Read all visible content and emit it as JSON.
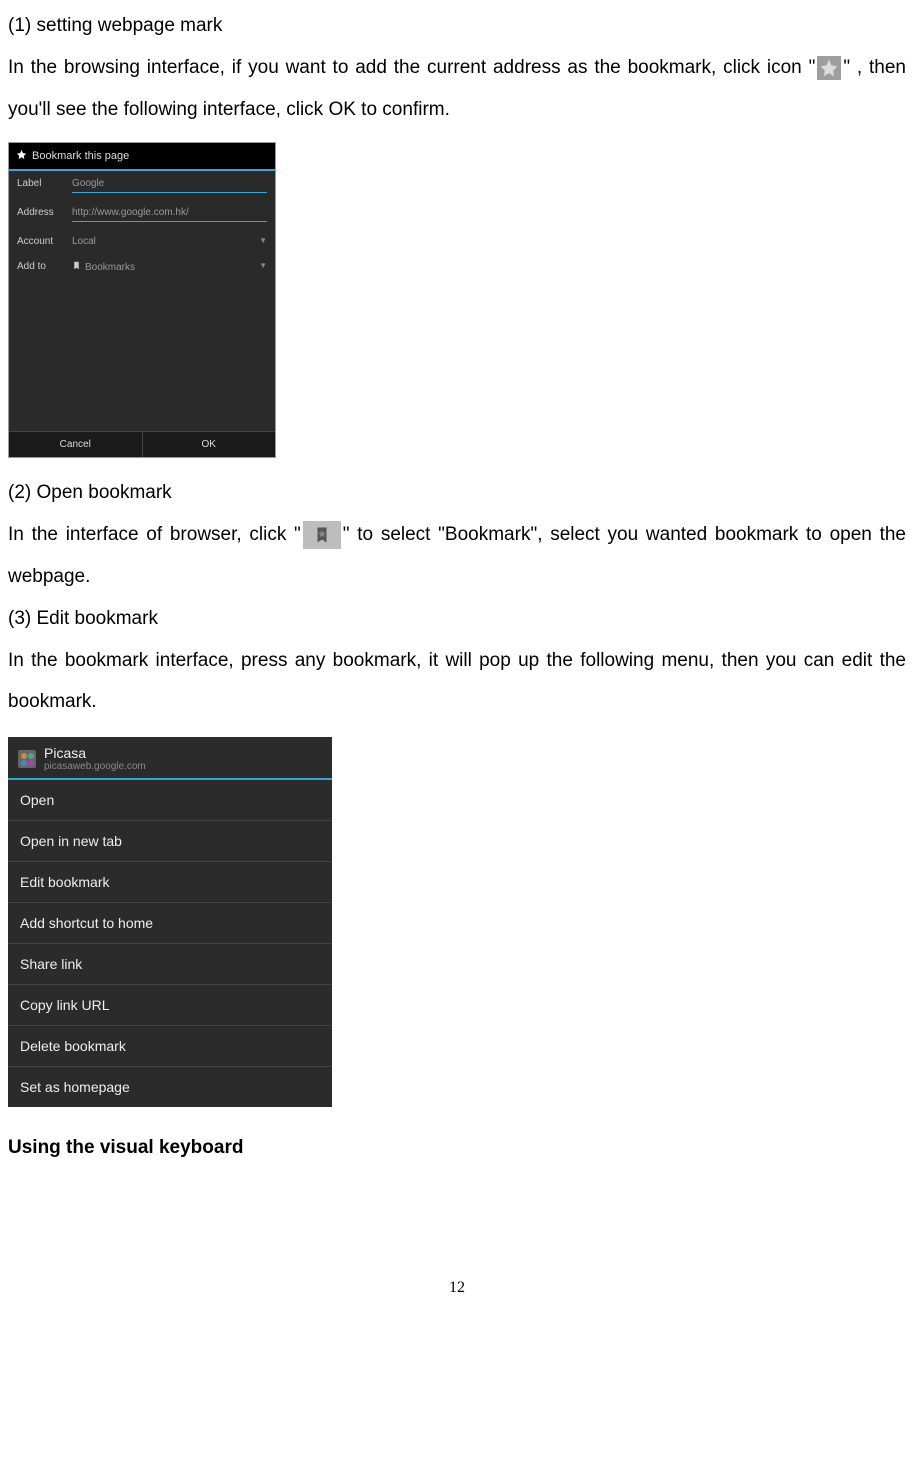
{
  "doc": {
    "h1": "(1)  setting webpage mark",
    "p1a": "In the browsing interface, if you want to add the current address as the bookmark, click icon \"",
    "p1b": "\" , then you'll see the following interface, click OK to confirm.",
    "h2": "(2)  Open bookmark",
    "p2a": "In the interface of browser, click \"",
    "p2b": "\" to select \"Bookmark\", select you wanted bookmark to open the webpage.",
    "h3": "(3)  Edit bookmark",
    "p3": "In the bookmark interface, press any bookmark, it will pop up the following menu, then you can edit the bookmark.",
    "h4": "Using the visual keyboard",
    "page_number": "12"
  },
  "shot1": {
    "title": "Bookmark this page",
    "rows": {
      "label_lbl": "Label",
      "label_val": "Google",
      "address_lbl": "Address",
      "address_val": "http://www.google.com.hk/",
      "account_lbl": "Account",
      "account_val": "Local",
      "addto_lbl": "Add to",
      "addto_val": "Bookmarks"
    },
    "buttons": {
      "cancel": "Cancel",
      "ok": "OK"
    }
  },
  "shot2": {
    "header_title": "Picasa",
    "header_url": "picasaweb.google.com",
    "items": [
      "Open",
      "Open in new tab",
      "Edit bookmark",
      "Add shortcut to home",
      "Share link",
      "Copy link URL",
      "Delete bookmark",
      "Set as homepage"
    ]
  }
}
